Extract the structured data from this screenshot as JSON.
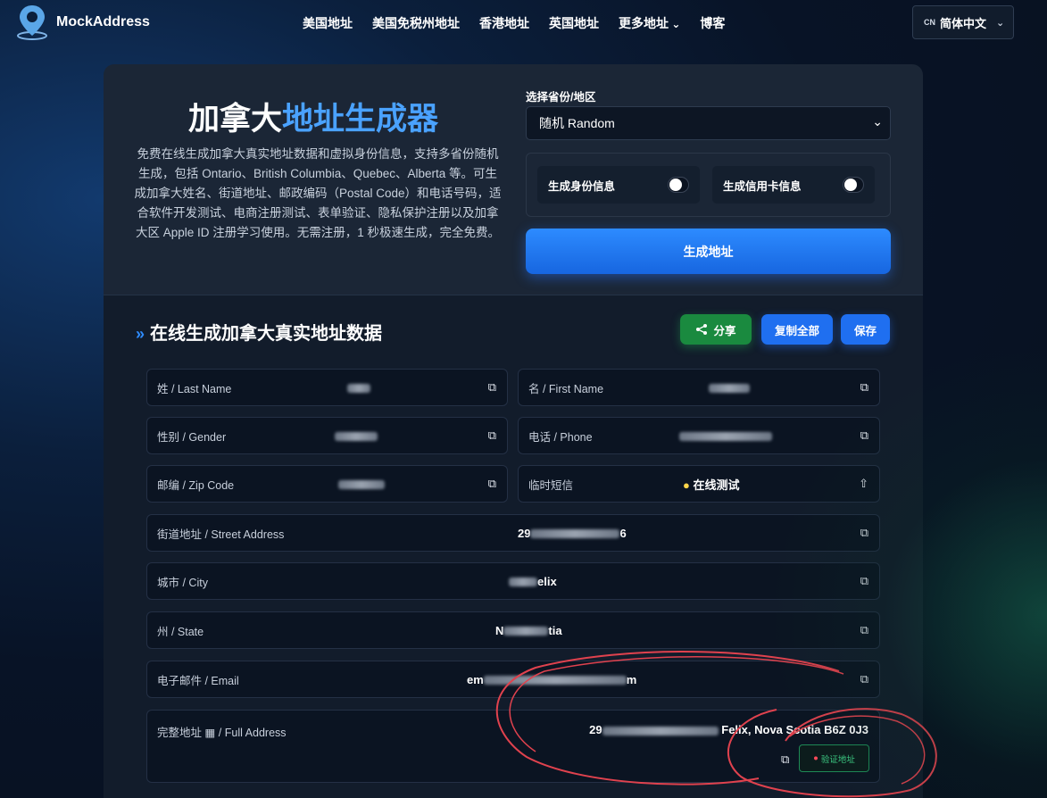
{
  "header": {
    "brand": "MockAddress",
    "nav": [
      "美国地址",
      "美国免税州地址",
      "香港地址",
      "英国地址",
      "更多地址",
      "博客"
    ],
    "lang_code": "CN",
    "lang_label": "简体中文"
  },
  "hero": {
    "title_part1": "加拿大",
    "title_part2": "地址生成器",
    "description": "免费在线生成加拿大真实地址数据和虚拟身份信息，支持多省份随机生成，包括 Ontario、British Columbia、Quebec、Alberta 等。可生成加拿大姓名、街道地址、邮政编码（Postal Code）和电话号码，适合软件开发测试、电商注册测试、表单验证、隐私保护注册以及加拿大区 Apple ID 注册学习使用。无需注册，1 秒极速生成，完全免费。"
  },
  "form": {
    "province_label": "选择省份/地区",
    "province_value": "随机 Random",
    "toggle_identity": "生成身份信息",
    "toggle_card": "生成信用卡信息",
    "generate_button": "生成地址"
  },
  "result": {
    "section_title": "在线生成加拿大真实地址数据",
    "share": "分享",
    "copy_all": "复制全部",
    "save": "保存",
    "fields": {
      "last_name": "姓 / Last Name",
      "first_name": "名 / First Name",
      "gender": "性别 / Gender",
      "phone": "电话 / Phone",
      "zip": "邮编 / Zip Code",
      "sms": "临时短信",
      "sms_value": "在线测试",
      "street": "街道地址 / Street Address",
      "street_prefix": "29",
      "street_suffix": "6",
      "city": "城市 / City",
      "city_suffix": "elix",
      "state": "州 / State",
      "state_prefix": "N",
      "state_suffix": "tia",
      "email": "电子邮件 / Email",
      "email_prefix": "em",
      "email_suffix": "m",
      "full_address": "完整地址",
      "full_address_en": "/ Full Address",
      "full_prefix": "29",
      "full_suffix": "Felix, Nova Scotia B6Z 0J3",
      "verify": "验证地址"
    }
  },
  "colors": {
    "accent_blue": "#4aa2ff",
    "share_green": "#1a8a3f",
    "annotation_red": "#e0424e"
  }
}
